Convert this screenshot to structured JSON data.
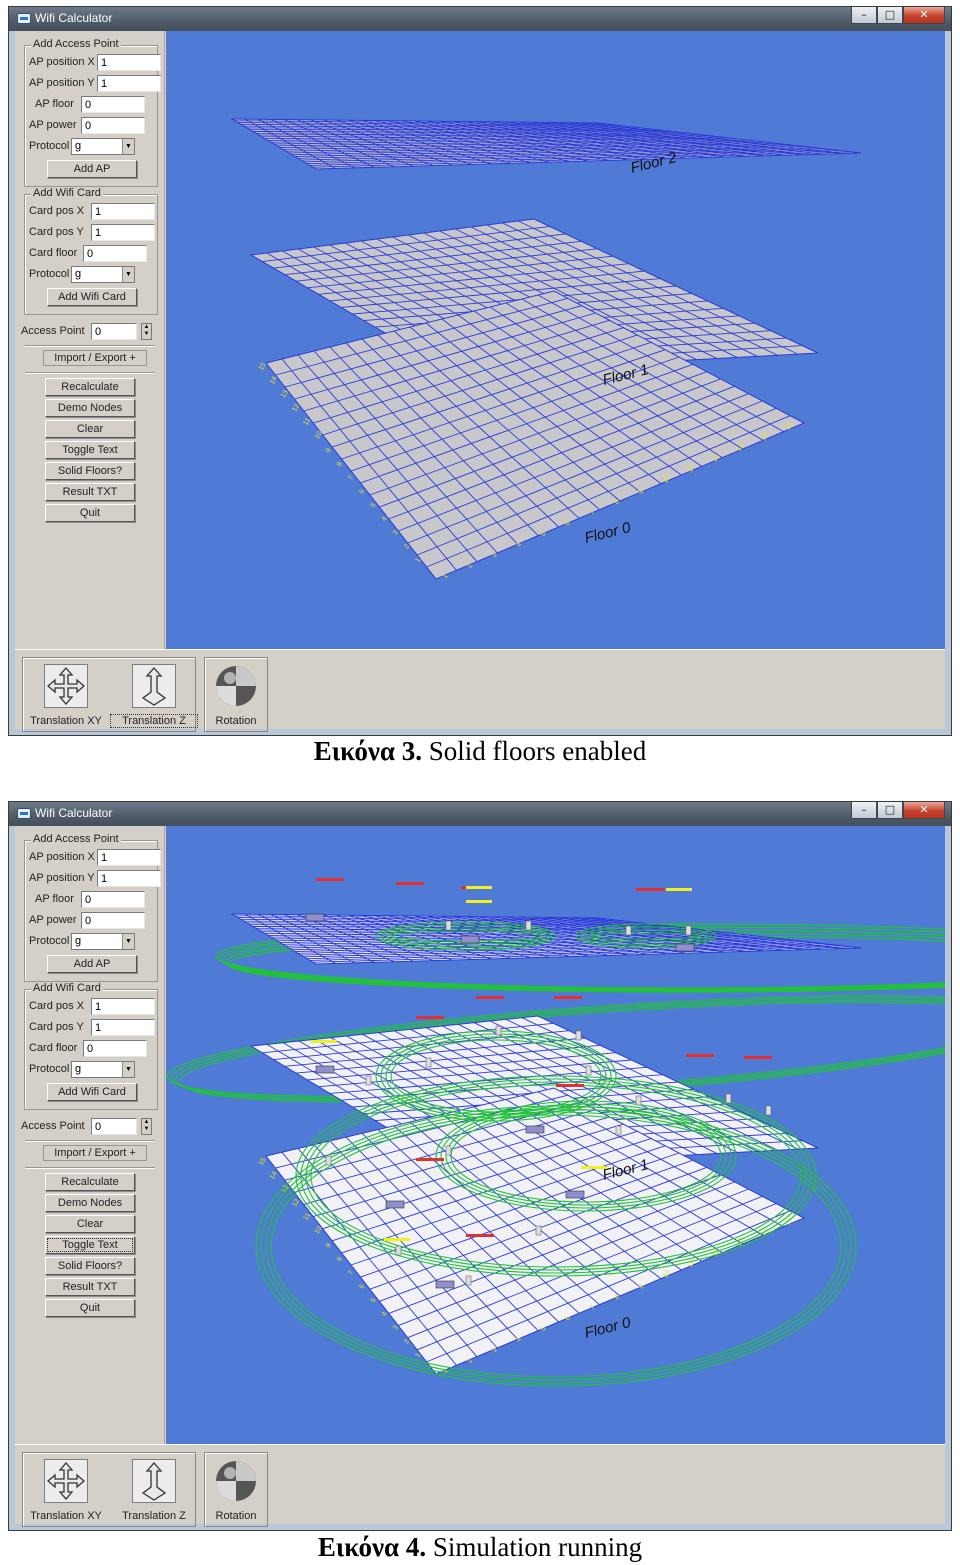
{
  "windows": [
    {
      "title": "Wifi Calculator",
      "window_buttons": {
        "minimize": "–",
        "maximize": "□",
        "close": "✕"
      },
      "add_ap": {
        "title": "Add Access Point",
        "x_label": "AP position X",
        "x_value": "1",
        "y_label": "AP position Y",
        "y_value": "1",
        "floor_label": "AP floor",
        "floor_value": "0",
        "power_label": "AP power",
        "power_value": "0",
        "protocol_label": "Protocol",
        "protocol_value": "g",
        "button": "Add AP"
      },
      "add_card": {
        "title": "Add Wifi Card",
        "x_label": "Card pos X",
        "x_value": "1",
        "y_label": "Card pos Y",
        "y_value": "1",
        "floor_label": "Card floor",
        "floor_value": "0",
        "protocol_label": "Protocol",
        "protocol_value": "g",
        "button": "Add Wifi Card"
      },
      "access_point_label": "Access Point",
      "access_point_value": "0",
      "import_export": "Import / Export",
      "actions": [
        "Recalculate",
        "Demo Nodes",
        "Clear",
        "Toggle Text",
        "Solid Floors?",
        "Result TXT",
        "Quit"
      ],
      "tools": [
        "Translation XY",
        "Translation Z",
        "Rotation"
      ],
      "floor_labels": [
        "Floor 2",
        "Floor 1",
        "Floor 0"
      ],
      "axis_ticks": [
        "1",
        "2",
        "3",
        "4",
        "5",
        "6",
        "7",
        "8",
        "9",
        "10",
        "11",
        "12",
        "13",
        "14",
        "15"
      ]
    },
    {
      "title": "Wifi Calculator",
      "window_buttons": {
        "minimize": "–",
        "maximize": "□",
        "close": "✕"
      },
      "add_ap": {
        "title": "Add Access Point",
        "x_label": "AP position X",
        "x_value": "1",
        "y_label": "AP position Y",
        "y_value": "1",
        "floor_label": "AP floor",
        "floor_value": "0",
        "power_label": "AP power",
        "power_value": "0",
        "protocol_label": "Protocol",
        "protocol_value": "g",
        "button": "Add AP"
      },
      "add_card": {
        "title": "Add Wifi Card",
        "x_label": "Card pos X",
        "x_value": "1",
        "y_label": "Card pos Y",
        "y_value": "1",
        "floor_label": "Card floor",
        "floor_value": "0",
        "protocol_label": "Protocol",
        "protocol_value": "g",
        "button": "Add Wifi Card"
      },
      "access_point_label": "Access Point",
      "access_point_value": "0",
      "import_export": "Import / Export",
      "actions": [
        "Recalculate",
        "Demo Nodes",
        "Clear",
        "Toggle Text",
        "Solid Floors?",
        "Result TXT",
        "Quit"
      ],
      "tools": [
        "Translation XY",
        "Translation Z",
        "Rotation"
      ],
      "floor_labels": [
        "Floor 1",
        "Floor 0"
      ],
      "axis_ticks": [
        "1",
        "2",
        "3",
        "4",
        "5",
        "6",
        "7",
        "8",
        "9",
        "10",
        "11",
        "12",
        "13",
        "14",
        "15"
      ]
    }
  ],
  "captions": [
    {
      "prefix": "Εικόνα 3.",
      "text": "Solid floors enabled"
    },
    {
      "prefix": "Εικόνα 4.",
      "text": "Simulation running"
    }
  ],
  "colors": {
    "viewport": "#4f7bd6",
    "grid_line": "#2a3bd6",
    "floor_fill_solid": "#c8c8cc",
    "floor_fill_open": "#f2f2f6",
    "coverage_ring": "#22c23a",
    "tick_label": "#e8e030",
    "node_label_red": "#e23030",
    "node_label_yellow": "#f0f020"
  }
}
